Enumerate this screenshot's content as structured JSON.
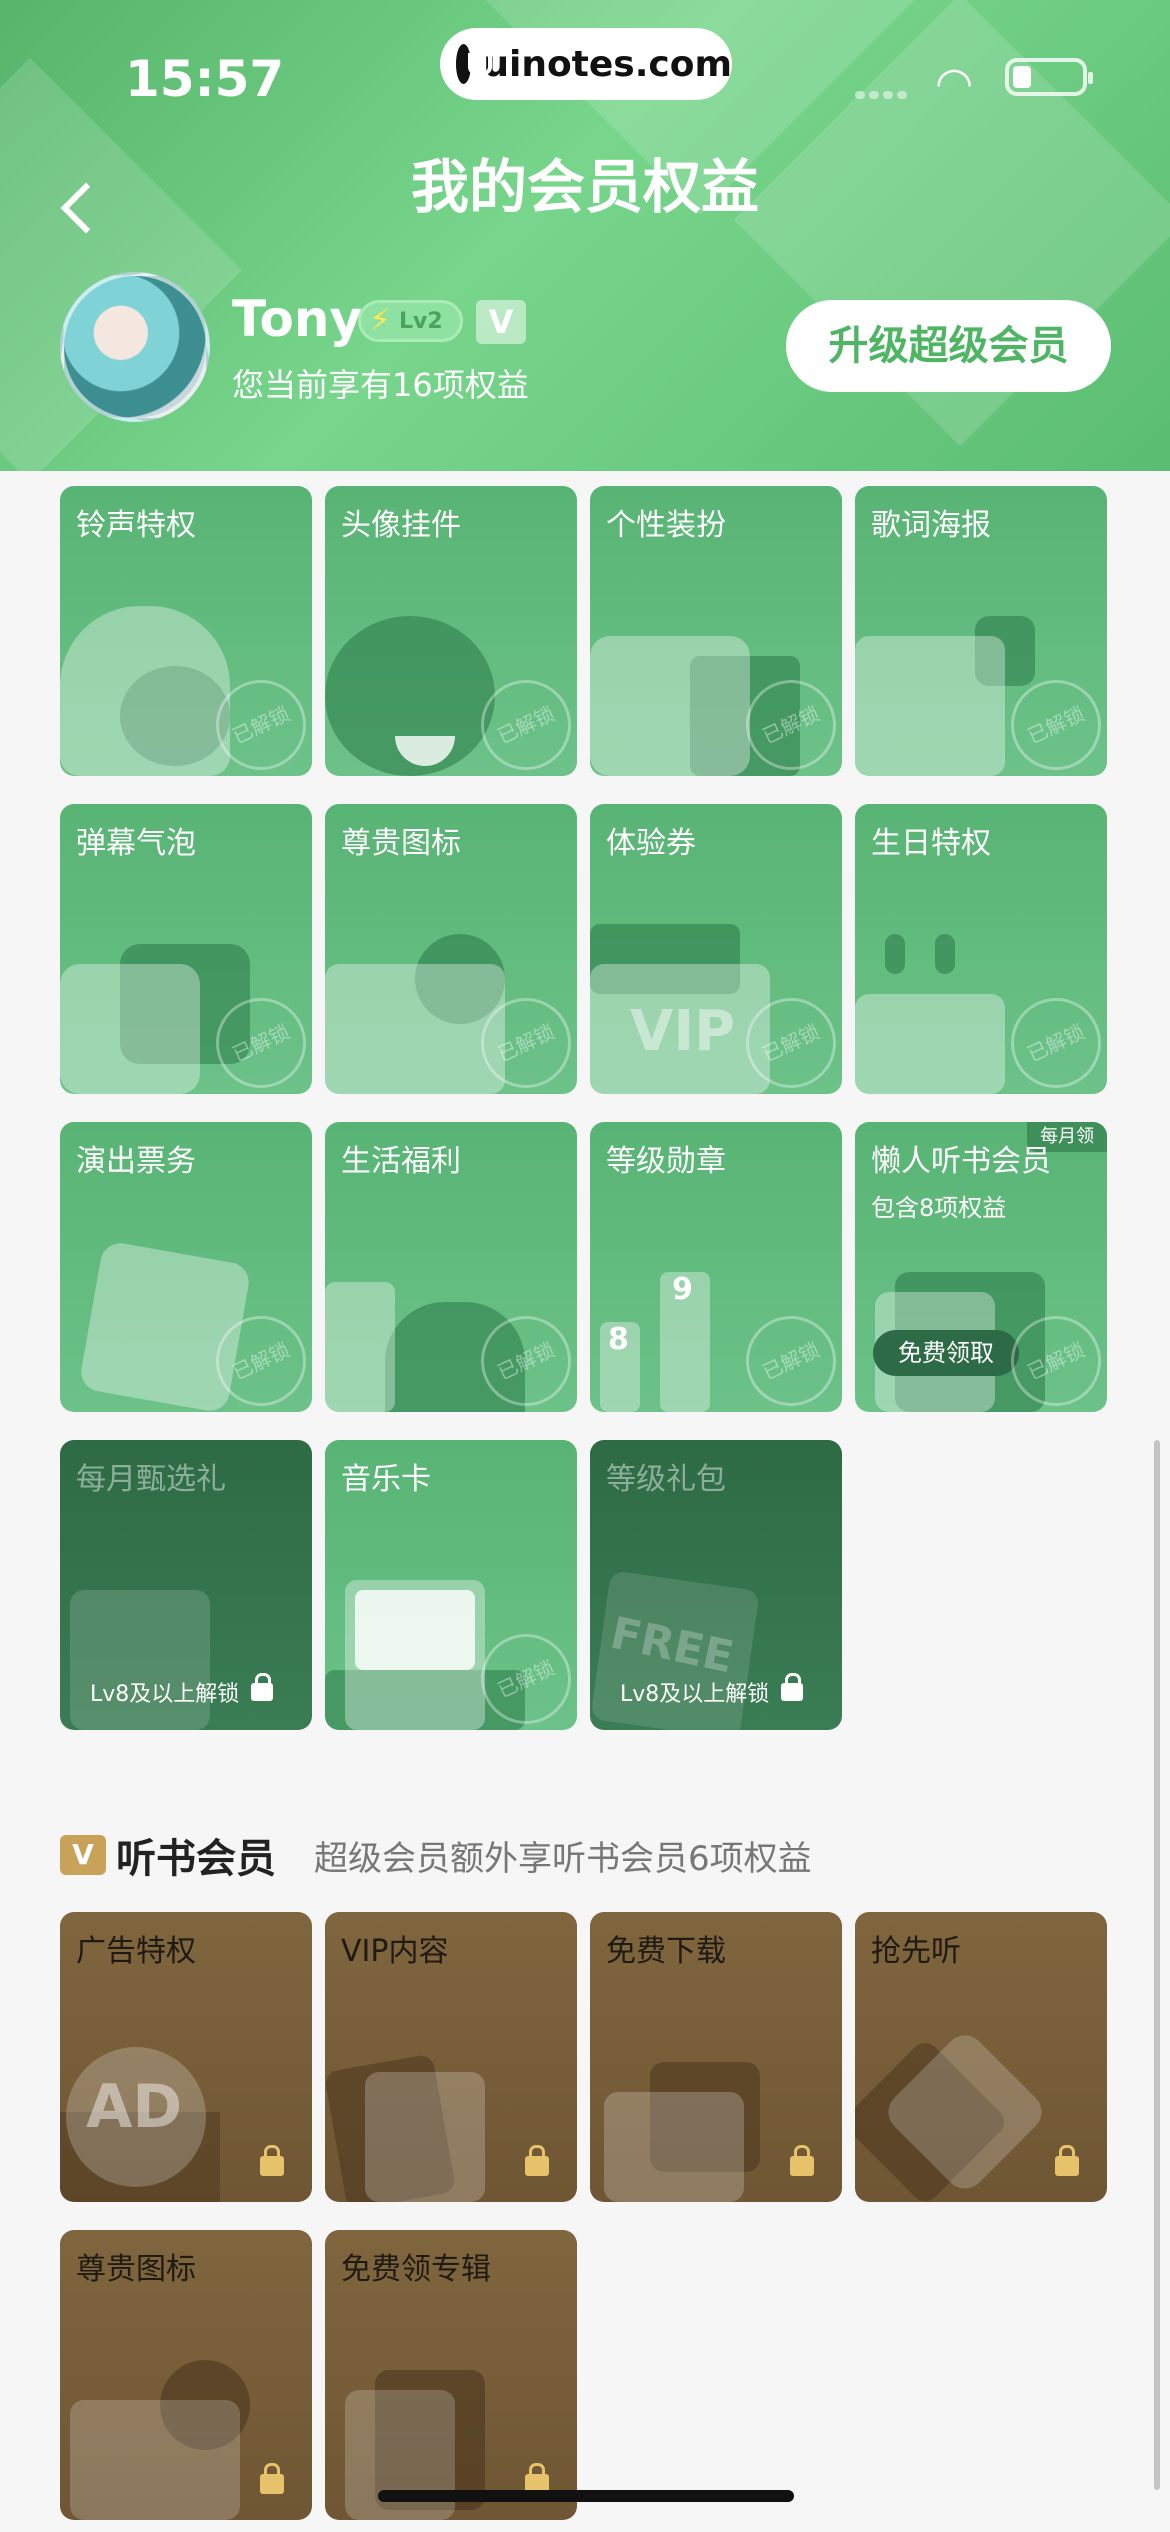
{
  "status_bar": {
    "time": "15:57",
    "url": "uinotes.com"
  },
  "header": {
    "title": "我的会员权益",
    "user_name": "Tony",
    "level": "Lv2",
    "v_badge": "V",
    "benefit_summary": "您当前享有16项权益",
    "upgrade_label": "升级超级会员"
  },
  "vip_benefits": [
    {
      "label": "铃声特权",
      "stamp": "已解锁"
    },
    {
      "label": "头像挂件",
      "stamp": "已解锁"
    },
    {
      "label": "个性装扮",
      "stamp": "已解锁"
    },
    {
      "label": "歌词海报",
      "stamp": "已解锁"
    },
    {
      "label": "弹幕气泡",
      "stamp": "已解锁"
    },
    {
      "label": "尊贵图标",
      "stamp": "已解锁"
    },
    {
      "label": "体验券",
      "stamp": "已解锁",
      "art_text": "VIP"
    },
    {
      "label": "生日特权",
      "stamp": "已解锁"
    },
    {
      "label": "演出票务",
      "stamp": "已解锁"
    },
    {
      "label": "生活福利",
      "stamp": "已解锁"
    },
    {
      "label": "等级勋章",
      "stamp": "已解锁",
      "art_text_a": "8",
      "art_text_b": "9"
    },
    {
      "label": "懒人听书会员",
      "sub": "包含8项权益",
      "tag": "每月领",
      "button": "免费领取",
      "stamp": "已解锁"
    },
    {
      "label": "每月甄选礼",
      "lock_text": "Lv8及以上解锁"
    },
    {
      "label": "音乐卡",
      "stamp": "已解锁"
    },
    {
      "label": "等级礼包",
      "lock_text": "Lv8及以上解锁",
      "art_text": "FREE"
    }
  ],
  "audiobook_section": {
    "logo": "V",
    "title": "听书会员",
    "description": "超级会员额外享听书会员6项权益",
    "items": [
      {
        "label": "广告特权",
        "art_text": "AD"
      },
      {
        "label": "VIP内容"
      },
      {
        "label": "免费下载"
      },
      {
        "label": "抢先听"
      },
      {
        "label": "尊贵图标"
      },
      {
        "label": "免费领专辑"
      }
    ]
  }
}
